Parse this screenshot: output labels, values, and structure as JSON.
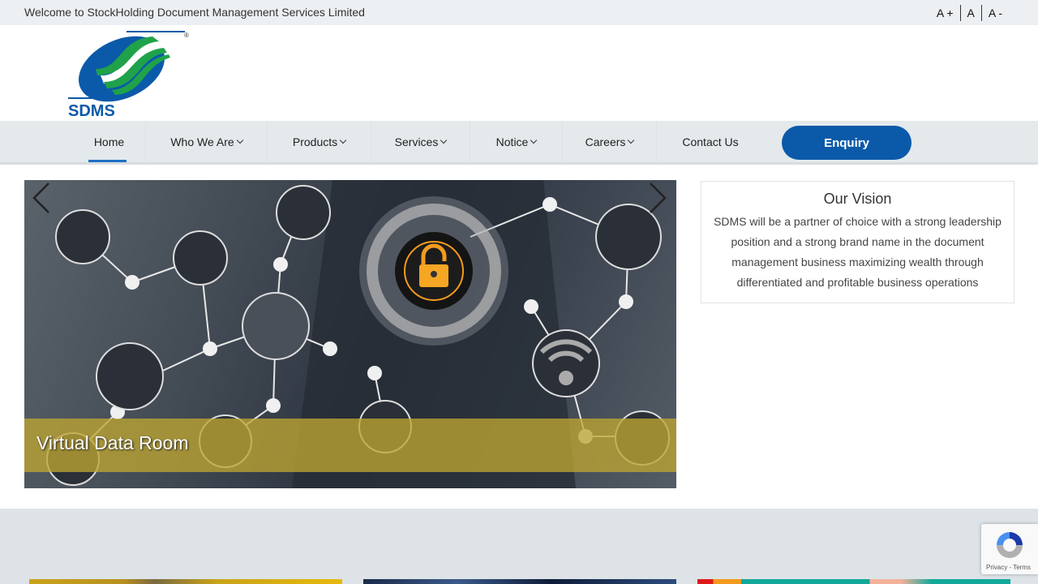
{
  "topbar": {
    "welcome": "Welcome to StockHolding Document Management Services Limited",
    "font_controls": [
      "A +",
      "A",
      "A -"
    ]
  },
  "logo": {
    "text": "SDMS",
    "mark": "®"
  },
  "nav": {
    "items": [
      {
        "label": "Home",
        "dropdown": false,
        "active": true
      },
      {
        "label": "Who We Are",
        "dropdown": true
      },
      {
        "label": "Products",
        "dropdown": true
      },
      {
        "label": "Services",
        "dropdown": true
      },
      {
        "label": "Notice",
        "dropdown": true
      },
      {
        "label": "Careers",
        "dropdown": true
      },
      {
        "label": "Contact Us",
        "dropdown": false
      }
    ],
    "cta": "Enquiry"
  },
  "slider": {
    "caption": "Virtual Data Room",
    "prev_icon": "chevron-left-icon",
    "next_icon": "chevron-right-icon"
  },
  "vision": {
    "title": "Our Vision",
    "text": "SDMS will be a partner of choice with a strong leadership position and a strong brand name in the document management business maximizing wealth through differentiated and profitable business operations"
  },
  "recaptcha": {
    "links": "Privacy - Terms"
  },
  "colors": {
    "brand_blue": "#0b5aa9",
    "brand_green": "#1fa24a",
    "nav_bg": "#e4e9ec",
    "caption_gold": "#bea532"
  }
}
